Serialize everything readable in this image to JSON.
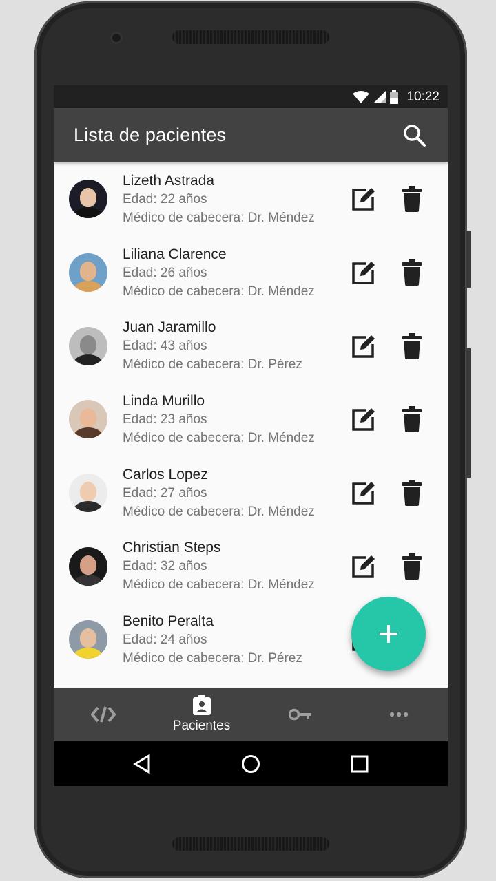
{
  "status_bar": {
    "time": "10:22",
    "icons": [
      "wifi-icon",
      "signal-icon",
      "battery-icon"
    ]
  },
  "app_bar": {
    "title": "Lista de pacientes",
    "search_icon": "search-icon"
  },
  "patients": [
    {
      "name": "Lizeth Astrada",
      "age": "Edad: 22 años",
      "doctor": "Médico de cabecera: Dr. Méndez",
      "avatar_bg": "#1c1c28",
      "skin": "#e8c4a8",
      "shirt": "#111"
    },
    {
      "name": "Liliana Clarence",
      "age": "Edad: 26 años",
      "doctor": "Médico de cabecera: Dr. Méndez",
      "avatar_bg": "#6fa0c8",
      "skin": "#e2b48c",
      "shirt": "#d9a25a"
    },
    {
      "name": "Juan Jaramillo",
      "age": "Edad: 43 años",
      "doctor": "Médico de cabecera: Dr. Pérez",
      "avatar_bg": "#bdbdbd",
      "skin": "#8a8a8a",
      "shirt": "#222"
    },
    {
      "name": "Linda Murillo",
      "age": "Edad: 23 años",
      "doctor": "Médico de cabecera: Dr. Méndez",
      "avatar_bg": "#d9c7b8",
      "skin": "#e9b99a",
      "shirt": "#5a3a2a"
    },
    {
      "name": "Carlos Lopez",
      "age": "Edad: 27 años",
      "doctor": "Médico de cabecera: Dr. Méndez",
      "avatar_bg": "#ececec",
      "skin": "#efcbb0",
      "shirt": "#2b2b2b"
    },
    {
      "name": "Christian Steps",
      "age": "Edad: 32 años",
      "doctor": "Médico de cabecera: Dr. Méndez",
      "avatar_bg": "#1a1a1a",
      "skin": "#d4a088",
      "shirt": "#333"
    },
    {
      "name": "Benito Peralta",
      "age": "Edad: 24 años",
      "doctor": "Médico de cabecera: Dr. Pérez",
      "avatar_bg": "#8e9aa6",
      "skin": "#e6bfa0",
      "shirt": "#f2d22e"
    }
  ],
  "row_actions": {
    "edit_icon": "edit-icon",
    "delete_icon": "trash-icon"
  },
  "fab": {
    "icon": "plus-icon",
    "color": "#26c6a9"
  },
  "bottom_nav": [
    {
      "icon": "code-icon",
      "label": ""
    },
    {
      "icon": "patient-card-icon",
      "label": "Pacientes"
    },
    {
      "icon": "key-icon",
      "label": ""
    },
    {
      "icon": "more-icon",
      "label": ""
    }
  ],
  "system_nav": [
    "back-icon",
    "home-icon",
    "recents-icon"
  ],
  "colors": {
    "app_bar": "#424242",
    "accent": "#26c6a9"
  }
}
